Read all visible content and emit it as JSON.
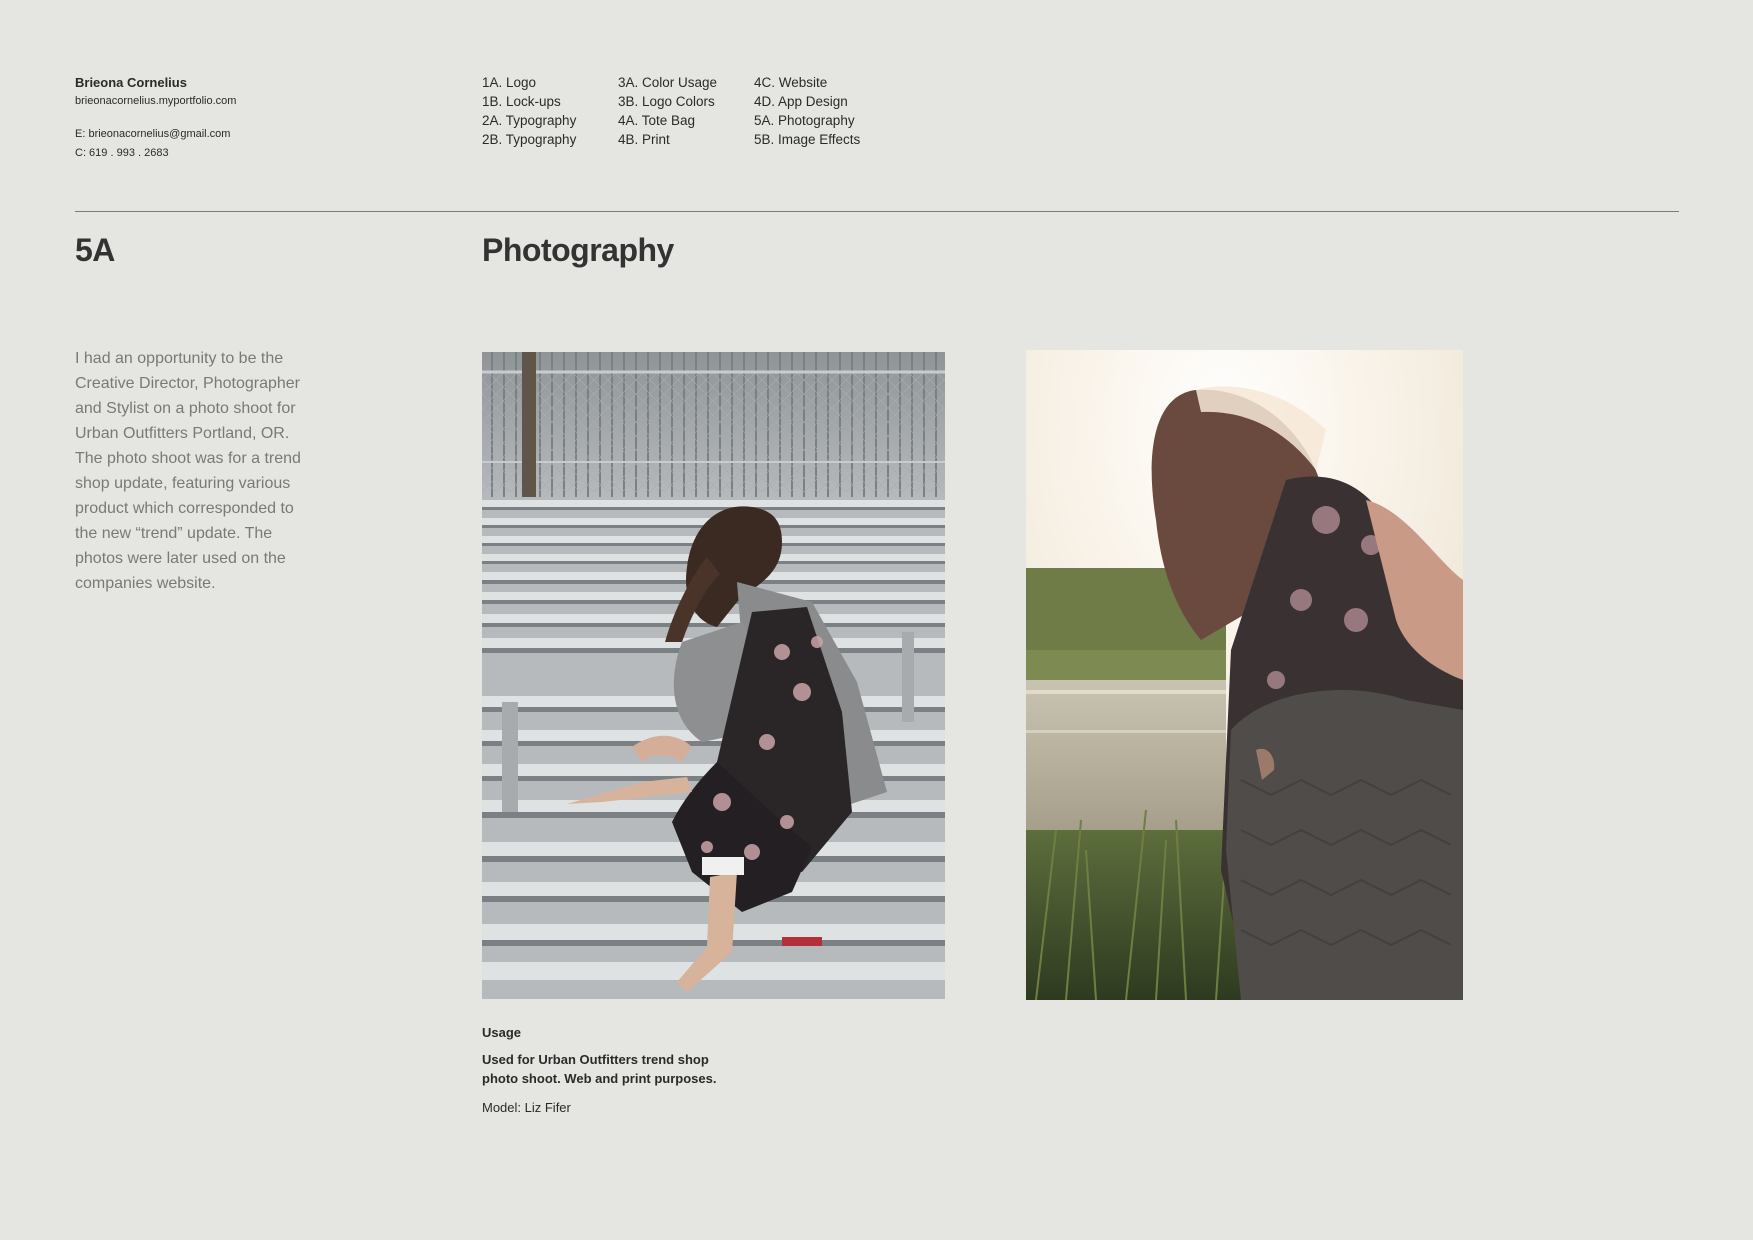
{
  "header": {
    "name": "Brieona Cornelius",
    "site": "brieonacornelius.myportfolio.com",
    "email": "E: brieonacornelius@gmail.com",
    "phone": "C: 619 . 993 . 2683"
  },
  "nav": {
    "col1": [
      "1A. Logo",
      "1B. Lock-ups",
      "2A. Typography",
      "2B. Typography"
    ],
    "col2": [
      "3A. Color Usage",
      "3B. Logo Colors",
      "4A. Tote Bag",
      "4B. Print"
    ],
    "col3": [
      "4C. Website",
      "4D. App Design",
      "5A. Photography",
      "5B. Image Effects"
    ]
  },
  "section": {
    "number": "5A",
    "title": "Photography",
    "description": "I had an opportunity to be the Creative Director, Photographer and Stylist on a photo shoot for Urban Outfitters Portland, OR. The photo shoot was for a trend shop update, featuring various product which corresponded to the new “trend” update. The photos were later used on the companies website."
  },
  "usage": {
    "heading": "Usage",
    "text": "Used for Urban Outfitters trend  shop photo shoot. Web and print purposes.",
    "model": "Model: Liz Fifer"
  }
}
